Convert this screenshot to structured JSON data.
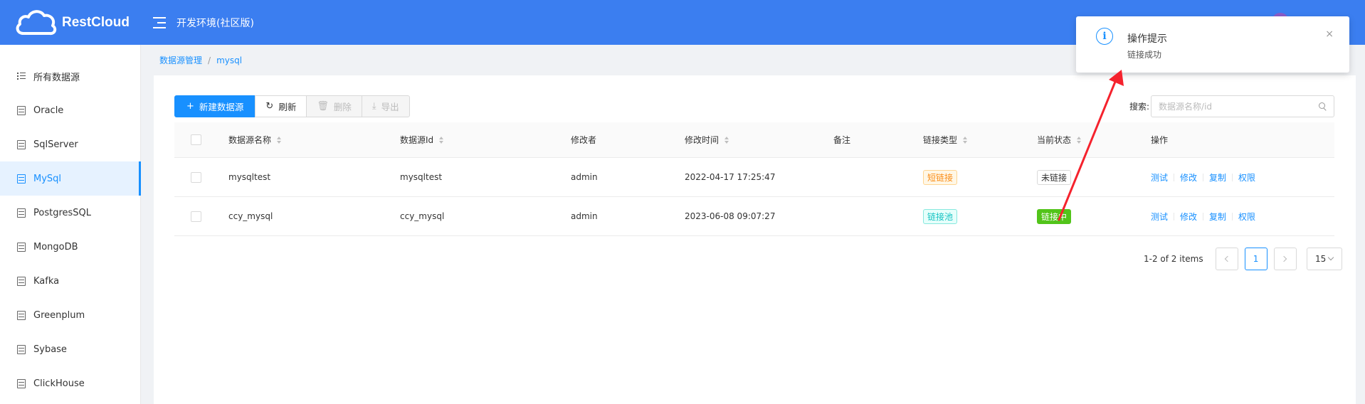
{
  "header": {
    "logo_text": "RestCloud",
    "env_title": "开发环境(社区版)"
  },
  "sidebar": {
    "items": [
      {
        "label": "所有数据源",
        "icon": "list-icon"
      },
      {
        "label": "Oracle",
        "icon": "database-icon"
      },
      {
        "label": "SqlServer",
        "icon": "database-icon"
      },
      {
        "label": "MySql",
        "icon": "database-icon",
        "active": true
      },
      {
        "label": "PostgresSQL",
        "icon": "database-icon"
      },
      {
        "label": "MongoDB",
        "icon": "database-icon"
      },
      {
        "label": "Kafka",
        "icon": "database-icon"
      },
      {
        "label": "Greenplum",
        "icon": "database-icon"
      },
      {
        "label": "Sybase",
        "icon": "database-icon"
      },
      {
        "label": "ClickHouse",
        "icon": "database-icon"
      }
    ]
  },
  "breadcrumb": {
    "root": "数据源管理",
    "sep": "/",
    "current": "mysql"
  },
  "toolbar": {
    "new_label": "新建数据源",
    "refresh_label": "刷新",
    "delete_label": "删除",
    "export_label": "导出"
  },
  "search": {
    "label": "搜索:",
    "placeholder": "数据源名称/id"
  },
  "table": {
    "headers": {
      "name": "数据源名称",
      "id": "数据源Id",
      "modifier": "修改者",
      "modified_time": "修改时间",
      "remark": "备注",
      "link_type": "链接类型",
      "status": "当前状态",
      "ops": "操作"
    },
    "rows": [
      {
        "name": "mysqltest",
        "id": "mysqltest",
        "modifier": "admin",
        "modified_time": "2022-04-17 17:25:47",
        "remark": "",
        "link_type": "短链接",
        "status": "未链接",
        "ops": {
          "test": "测试",
          "edit": "修改",
          "copy": "复制",
          "perm": "权限"
        }
      },
      {
        "name": "ccy_mysql",
        "id": "ccy_mysql",
        "modifier": "admin",
        "modified_time": "2023-06-08 09:07:27",
        "remark": "",
        "link_type": "链接池",
        "status": "链接中",
        "ops": {
          "test": "测试",
          "edit": "修改",
          "copy": "复制",
          "perm": "权限"
        }
      }
    ]
  },
  "pagination": {
    "total_text": "1-2 of 2 items",
    "current_page": "1",
    "page_size": "15"
  },
  "notification": {
    "title": "操作提示",
    "message": "链接成功",
    "close": "×"
  },
  "colors": {
    "header_bg": "#3b7ef0",
    "primary": "#1890ff",
    "annotation_arrow": "#f5222d"
  }
}
